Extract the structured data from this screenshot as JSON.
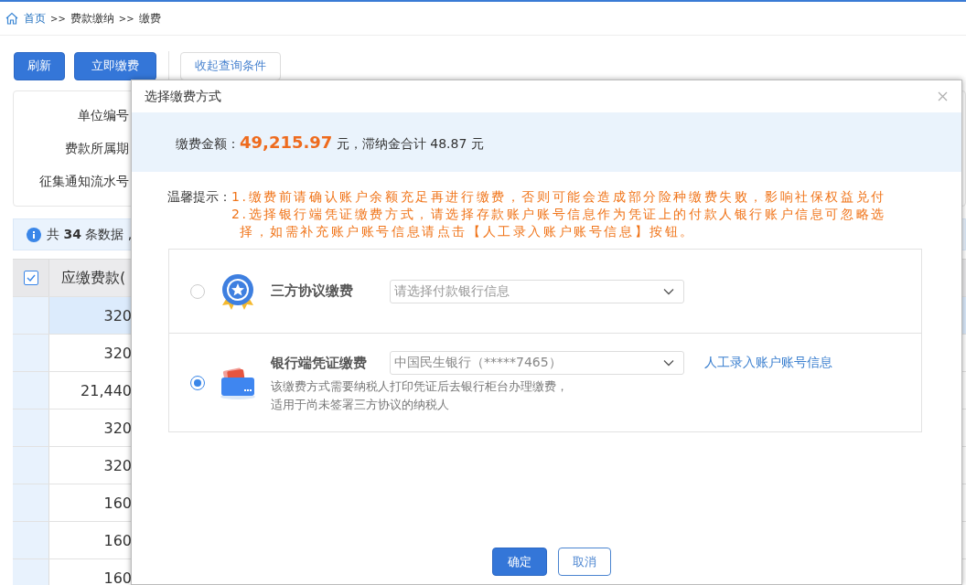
{
  "breadcrumb": [
    {
      "kind": "link",
      "label": "首页"
    },
    {
      "kind": "separator",
      "label": ">>"
    },
    {
      "kind": "text",
      "label": "费款缴纳"
    },
    {
      "kind": "separator",
      "label": ">>"
    },
    {
      "kind": "text",
      "label": "缴费"
    }
  ],
  "toolbar": {
    "buttons": [
      {
        "kind": "primary",
        "label": "刷新"
      },
      {
        "kind": "primary",
        "label": "立即缴费"
      },
      {
        "kind": "outline",
        "label": "收起查询条件"
      }
    ]
  },
  "query_form": {
    "labels": [
      "单位编号",
      "费款所属期",
      "征集通知流水号"
    ]
  },
  "info_bar": {
    "text": "共 **34** 条数据 ,"
  },
  "table": {
    "header_checked": true,
    "columns": [
      "应缴费款("
    ],
    "rows": [
      {
        "selected": true,
        "cells": [
          "320"
        ]
      },
      {
        "selected": false,
        "cells": [
          "320"
        ]
      },
      {
        "selected": false,
        "cells": [
          "21,440"
        ]
      },
      {
        "selected": false,
        "cells": [
          "320"
        ]
      },
      {
        "selected": false,
        "cells": [
          "320"
        ]
      },
      {
        "selected": false,
        "cells": [
          "160"
        ]
      },
      {
        "selected": false,
        "cells": [
          "160"
        ]
      },
      {
        "selected": false,
        "cells": [
          "160"
        ]
      }
    ]
  },
  "dialog": {
    "title": "选择缴费方式",
    "amount_line": "缴费金额：**49,215.97** 元，滞纳金合计 48.87 元",
    "notice": {
      "label": "温馨提示：",
      "lines": [
        "1.缴费前请确认账户余额充足再进行缴费，否则可能会造成部分险种缴费失败，影响社保权益兑付",
        "2.选择银行端凭证缴费方式，请选择存款账户账号信息作为凭证上的付款人银行账户信息可忽略选择，如需补充账户账号信息请点击【人工录入账户账号信息】按钮。"
      ]
    },
    "options": [
      {
        "kind": "badge",
        "selected": false,
        "title": "三方协议缴费",
        "select": {
          "placeholder": "请选择付款银行信息"
        }
      },
      {
        "kind": "card",
        "selected": true,
        "title": "银行端凭证缴费",
        "select": {
          "value": "中国民生银行（*****7465）"
        },
        "link": "人工录入账户账号信息",
        "description": [
          "该缴费方式需要纳税人打印凭证后去银行柜台办理缴费，",
          "适用于尚未签署三方协议的纳税人"
        ]
      }
    ],
    "buttons": [
      {
        "kind": "primary",
        "label": "确定"
      },
      {
        "kind": "outline",
        "label": "取消"
      }
    ]
  }
}
